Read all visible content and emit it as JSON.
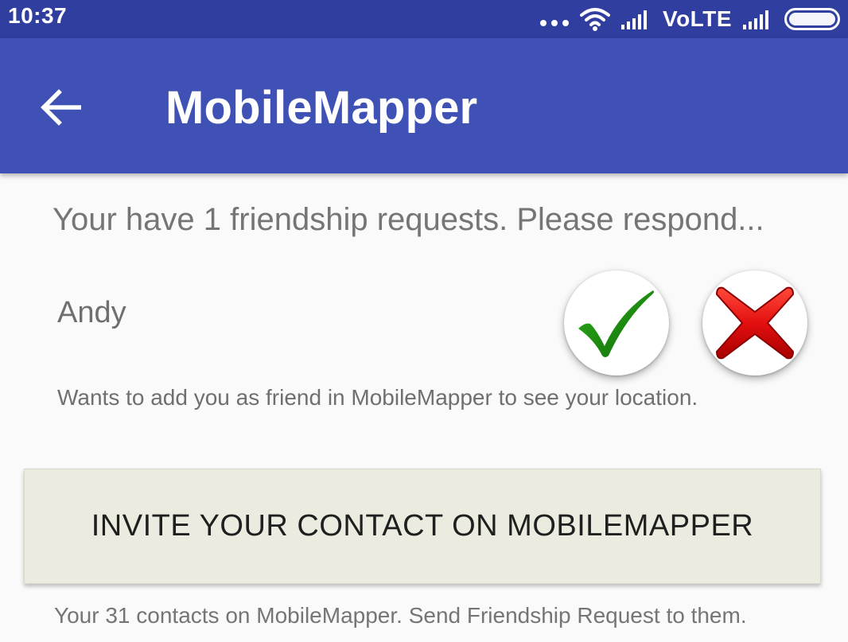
{
  "status_bar": {
    "time": "10:37",
    "network_label": "VoLTE",
    "icons": [
      "more-dots-icon",
      "wifi-icon",
      "signal-icon",
      "signal-icon",
      "battery-icon"
    ]
  },
  "app_bar": {
    "title": "MobileMapper",
    "back_icon": "arrow-left-icon",
    "color": "#3f51b5",
    "status_color": "#303f9f"
  },
  "requests": {
    "header": "Your have 1 friendship requests. Please respond...",
    "items": [
      {
        "name": "Andy",
        "description": "Wants to add you as friend in MobileMapper to see your location.",
        "accept_icon": "green-checkmark-icon",
        "reject_icon": "red-x-icon"
      }
    ]
  },
  "invite": {
    "button_label": "INVITE YOUR CONTACT ON MOBILEMAPPER",
    "info": "Your 31 contacts on MobileMapper. Send Friendship Request to them."
  },
  "colors": {
    "accept_green": "#1f8a12",
    "reject_red": "#d40000",
    "invite_bg": "#ebebe0"
  }
}
